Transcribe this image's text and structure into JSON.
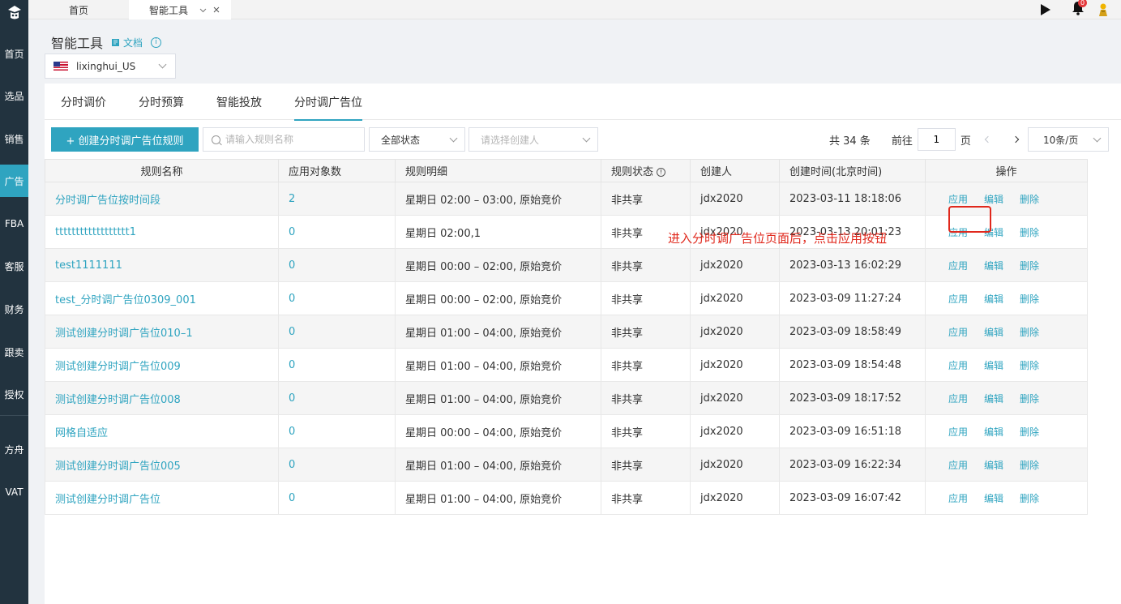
{
  "sidebar": {
    "items": [
      "首页",
      "选品",
      "销售",
      "广告",
      "FBA",
      "客服",
      "财务",
      "跟卖",
      "授权",
      "方舟",
      "VAT"
    ],
    "active": "广告",
    "bg_color": "#22333f",
    "active_color": "#2fa4c0"
  },
  "topbar": {
    "tabs": [
      "首页",
      "智能工具"
    ],
    "notification_count": "0"
  },
  "page": {
    "title": "智能工具",
    "doc_link": "文档",
    "store": "lixinghui_US"
  },
  "subtabs": [
    "分时调价",
    "分时预算",
    "智能投放",
    "分时调广告位"
  ],
  "active_subtab": "分时调广告位",
  "toolbar": {
    "create_button": "+ 创建分时调广告位规则",
    "search_placeholder": "请输入规则名称",
    "status_select": "全部状态",
    "creator_placeholder": "请选择创建人",
    "total": "共 34 条",
    "goto_label": "前往",
    "page_value": "1",
    "page_suffix": "页",
    "page_size": "10条/页"
  },
  "table": {
    "columns": [
      "规则名称",
      "应用对象数",
      "规则明细",
      "规则状态",
      "创建人",
      "创建时间(北京时间)",
      "操作"
    ],
    "actions": [
      "应用",
      "编辑",
      "删除"
    ],
    "rows": [
      {
        "name": "分时调广告位按时间段",
        "count": "2",
        "detail": "星期日 02:00 – 03:00, 原始竞价",
        "status": "非共享",
        "creator": "jdx2020",
        "created": "2023-03-11 18:18:06"
      },
      {
        "name": "tttttttttttttttttt1",
        "count": "0",
        "detail": "星期日 02:00,1",
        "status": "非共享",
        "creator": "jdx2020",
        "created": "2023-03-13 20:01:23"
      },
      {
        "name": "test1111111",
        "count": "0",
        "detail": "星期日 00:00 – 02:00, 原始竞价",
        "status": "非共享",
        "creator": "jdx2020",
        "created": "2023-03-13 16:02:29"
      },
      {
        "name": "test_分时调广告位0309_001",
        "count": "0",
        "detail": "星期日 00:00 – 02:00, 原始竞价",
        "status": "非共享",
        "creator": "jdx2020",
        "created": "2023-03-09 11:27:24"
      },
      {
        "name": "测试创建分时调广告位010–1",
        "count": "0",
        "detail": "星期日 01:00 – 04:00, 原始竞价",
        "status": "非共享",
        "creator": "jdx2020",
        "created": "2023-03-09 18:58:49"
      },
      {
        "name": "测试创建分时调广告位009",
        "count": "0",
        "detail": "星期日 01:00 – 04:00, 原始竞价",
        "status": "非共享",
        "creator": "jdx2020",
        "created": "2023-03-09 18:54:48"
      },
      {
        "name": "测试创建分时调广告位008",
        "count": "0",
        "detail": "星期日 01:00 – 04:00, 原始竞价",
        "status": "非共享",
        "creator": "jdx2020",
        "created": "2023-03-09 18:17:52"
      },
      {
        "name": "网格自适应",
        "count": "0",
        "detail": "星期日 00:00 – 04:00, 原始竞价",
        "status": "非共享",
        "creator": "jdx2020",
        "created": "2023-03-09 16:51:18"
      },
      {
        "name": "测试创建分时调广告位005",
        "count": "0",
        "detail": "星期日 01:00 – 04:00, 原始竞价",
        "status": "非共享",
        "creator": "jdx2020",
        "created": "2023-03-09 16:22:34"
      },
      {
        "name": "测试创建分时调广告位",
        "count": "0",
        "detail": "星期日 01:00 – 04:00, 原始竞价",
        "status": "非共享",
        "creator": "jdx2020",
        "created": "2023-03-09 16:07:42"
      }
    ]
  },
  "annotation": "进入分时调广告位页面后，点击应用按钮",
  "colors": {
    "accent": "#2fa4c0",
    "annotation": "#e0281c"
  }
}
